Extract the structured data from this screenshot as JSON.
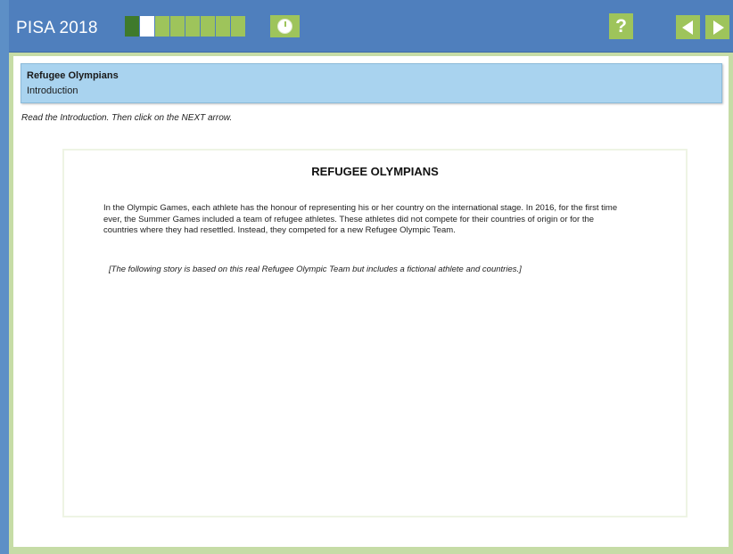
{
  "app": {
    "title": "PISA 2018"
  },
  "progress": {
    "total_segments": 8,
    "completed_segments": 1,
    "current_segment": 2
  },
  "toolbar": {
    "help_label": "?"
  },
  "unit": {
    "title": "Refugee Olympians",
    "subtitle": "Introduction"
  },
  "instruction": "Read the Introduction. Then click on the NEXT arrow.",
  "document": {
    "heading": "REFUGEE OLYMPIANS",
    "paragraph": "In the Olympic Games, each athlete has the honour of representing his or her country on the international stage. In 2016, for the first time ever, the Summer Games included a team of refugee athletes. These athletes did not compete for their countries of origin or for the countries where they had resettled. Instead, they competed for a new Refugee Olympic Team.",
    "note": "[The following story is based on this real Refugee Olympic Team but includes a fictional athlete and countries.]"
  },
  "colors": {
    "header_blue": "#4f7fbd",
    "accent_green": "#9ec45b",
    "dark_green": "#3f7a2b",
    "unit_header_blue": "#a9d3ef",
    "frame_green": "#c6dca6"
  },
  "icons": {
    "timer": "timer-icon",
    "help": "help-icon",
    "previous": "arrow-left-icon",
    "next": "arrow-right-icon"
  }
}
